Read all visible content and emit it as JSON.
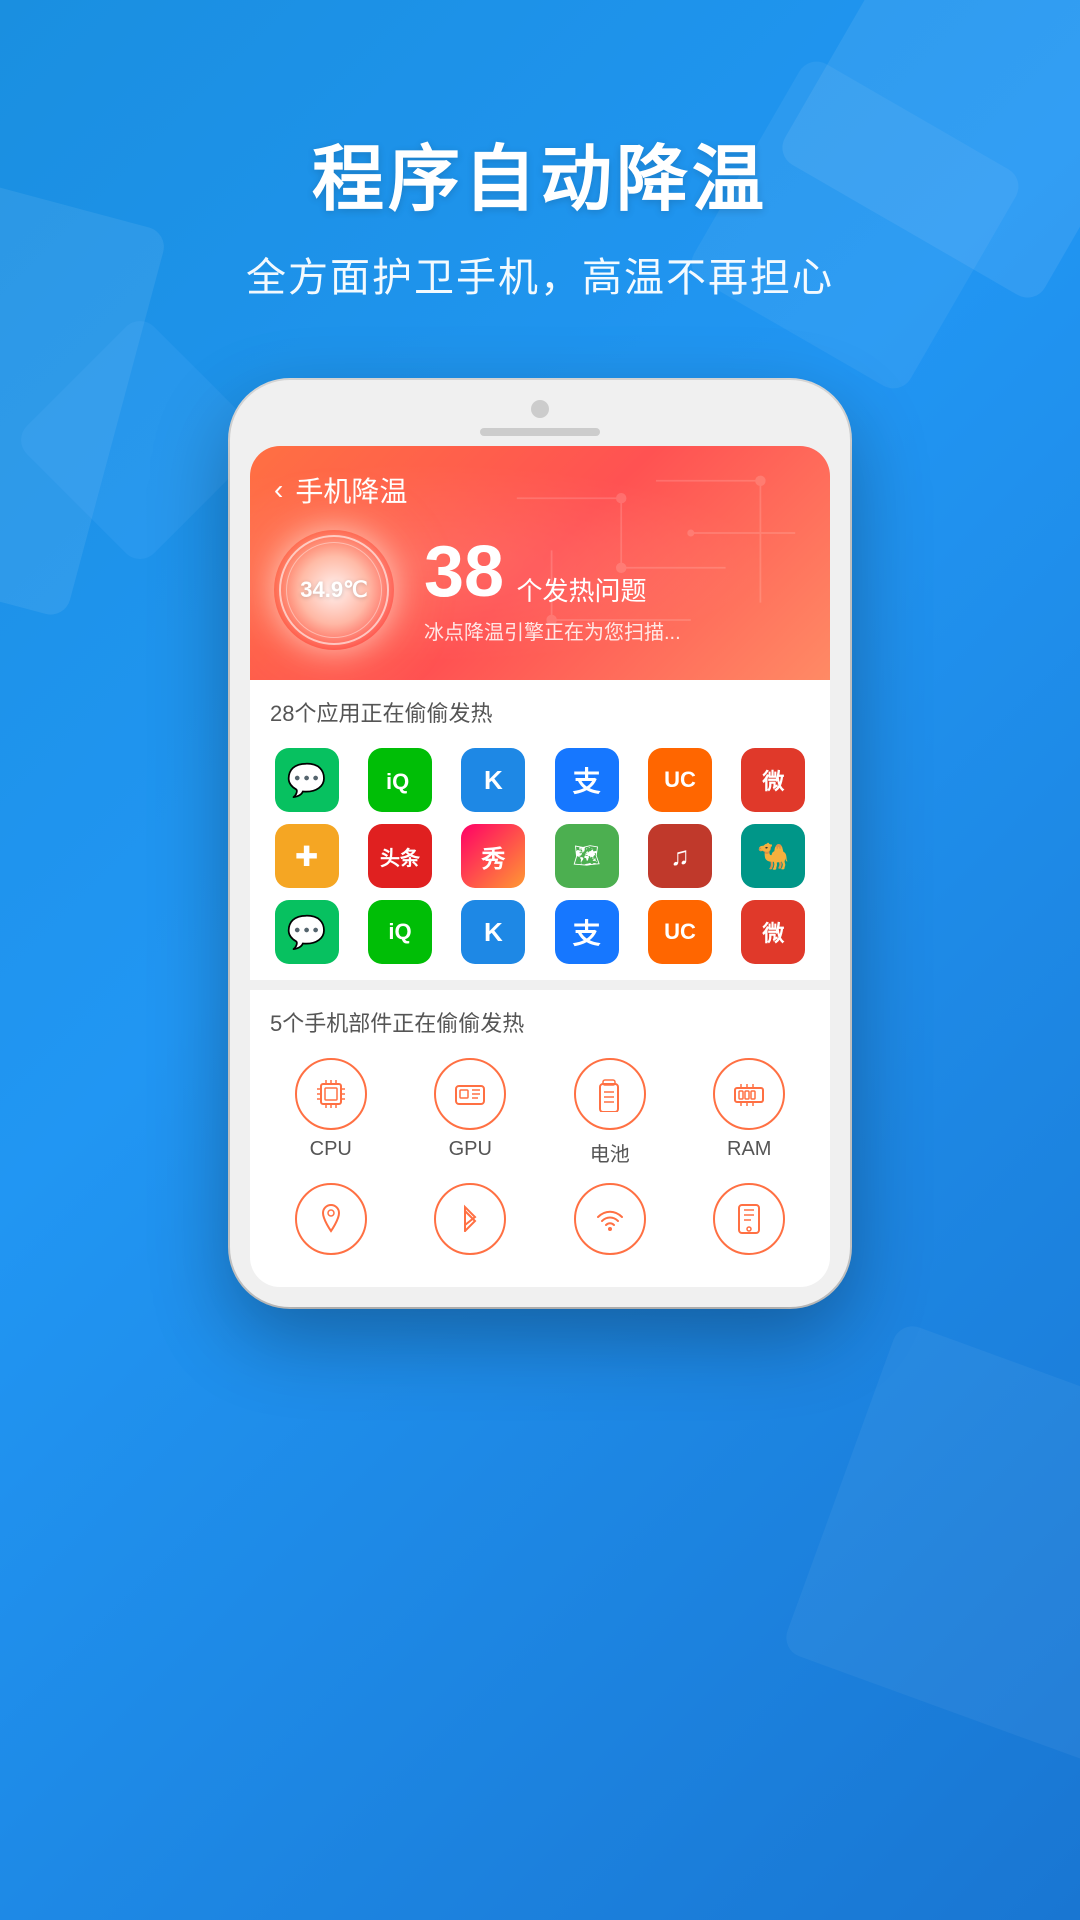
{
  "background": {
    "color_start": "#1a8fe0",
    "color_end": "#1976d2"
  },
  "header": {
    "title": "程序自动降温",
    "subtitle": "全方面护卫手机，高温不再担心"
  },
  "phone": {
    "app_title": "手机降温",
    "temperature": "34.9℃",
    "heat_count": "38",
    "heat_label": "个发热问题",
    "heat_sub": "冰点降温引擎正在为您扫描...",
    "apps_section_title": "28个应用正在偷偷发热",
    "hardware_section_title": "5个手机部件正在偷偷发热"
  },
  "apps": [
    {
      "name": "wechat",
      "emoji": "💬",
      "bg": "#07c160"
    },
    {
      "name": "iqiyi",
      "emoji": "▶",
      "bg": "#00be06"
    },
    {
      "name": "kuwo",
      "emoji": "K",
      "bg": "#1e88e5"
    },
    {
      "name": "alipay",
      "emoji": "支",
      "bg": "#1677ff"
    },
    {
      "name": "uc",
      "emoji": "U",
      "bg": "#ff6600"
    },
    {
      "name": "weibo",
      "emoji": "微",
      "bg": "#e0392a"
    },
    {
      "name": "jianbing",
      "emoji": "✚",
      "bg": "#f5a623"
    },
    {
      "name": "toutiao",
      "emoji": "头",
      "bg": "#e02020"
    },
    {
      "name": "xiuxiu",
      "emoji": "秀",
      "bg": "#f06"
    },
    {
      "name": "maps",
      "emoji": "◈",
      "bg": "#4caf50"
    },
    {
      "name": "netease",
      "emoji": "♫",
      "bg": "#c0392b"
    },
    {
      "name": "sohu",
      "emoji": "🐪",
      "bg": "#009688"
    },
    {
      "name": "wechat2",
      "emoji": "💬",
      "bg": "#07c160"
    },
    {
      "name": "iqiyi2",
      "emoji": "▶",
      "bg": "#00be06"
    },
    {
      "name": "kuwo2",
      "emoji": "K",
      "bg": "#1e88e5"
    },
    {
      "name": "alipay2",
      "emoji": "支",
      "bg": "#1677ff"
    },
    {
      "name": "uc2",
      "emoji": "U",
      "bg": "#ff6600"
    },
    {
      "name": "weibo2",
      "emoji": "微",
      "bg": "#e0392a"
    }
  ],
  "hardware": [
    {
      "id": "cpu",
      "label": "CPU",
      "icon": "cpu"
    },
    {
      "id": "gpu",
      "label": "GPU",
      "icon": "gpu"
    },
    {
      "id": "battery",
      "label": "电池",
      "icon": "battery"
    },
    {
      "id": "ram",
      "label": "RAM",
      "icon": "ram"
    }
  ],
  "hardware2": [
    {
      "id": "location",
      "label": "",
      "icon": "location"
    },
    {
      "id": "bluetooth",
      "label": "",
      "icon": "bluetooth"
    },
    {
      "id": "wifi",
      "label": "",
      "icon": "wifi"
    },
    {
      "id": "screen",
      "label": "",
      "icon": "screen"
    }
  ]
}
